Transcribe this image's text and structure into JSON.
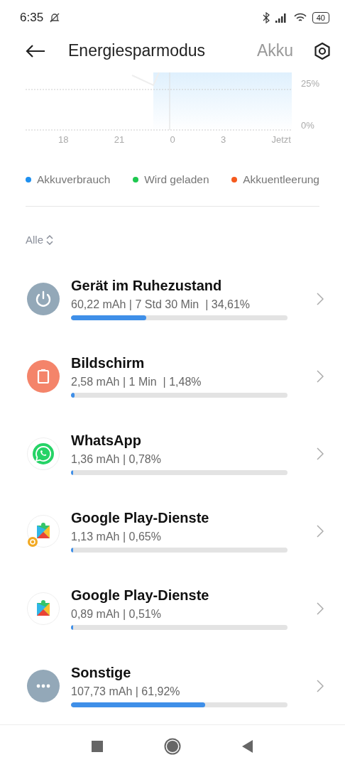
{
  "status_bar": {
    "time": "6:35",
    "battery": "40"
  },
  "header": {
    "title": "Energiesparmodus",
    "next_tab": "Akku"
  },
  "chart": {
    "y_labels": [
      "25%",
      "0%"
    ],
    "x_labels": [
      "18",
      "21",
      "0",
      "3",
      "Jetzt"
    ]
  },
  "legend": [
    {
      "label": "Akkuverbrauch",
      "color": "#1e90f0"
    },
    {
      "label": "Wird geladen",
      "color": "#1ec850"
    },
    {
      "label": "Akkuentleerung",
      "color": "#f55a1e"
    }
  ],
  "filter": {
    "label": "Alle"
  },
  "apps": [
    {
      "kind": "power",
      "name": "Gerät im Ruhezustand",
      "detail": "60,22 mAh | 7 Std 30 Min  | 34,61%",
      "level": 0.3461
    },
    {
      "kind": "screen",
      "name": "Bildschirm",
      "detail": "2,58 mAh | 1 Min  | 1,48%",
      "level": 0.0148
    },
    {
      "kind": "whatsapp",
      "name": "WhatsApp",
      "detail": "1,36 mAh | 0,78%",
      "level": 0.0078
    },
    {
      "kind": "play_linked",
      "name": "Google Play-Dienste",
      "detail": "1,13 mAh | 0,65%",
      "level": 0.0065
    },
    {
      "kind": "play",
      "name": "Google Play-Dienste",
      "detail": "0,89 mAh | 0,51%",
      "level": 0.0051
    },
    {
      "kind": "other",
      "name": "Sonstige",
      "detail": "107,73 mAh | 61,92%",
      "level": 0.6192
    }
  ]
}
